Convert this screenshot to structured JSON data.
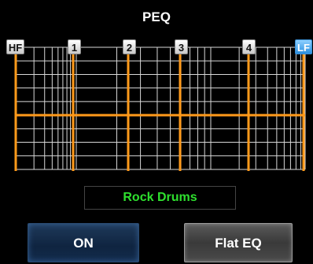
{
  "header": {
    "title": "PEQ"
  },
  "eq": {
    "bands": [
      {
        "id": "hf",
        "label": "HF"
      },
      {
        "id": "b1",
        "label": "1"
      },
      {
        "id": "b2",
        "label": "2"
      },
      {
        "id": "b3",
        "label": "3"
      },
      {
        "id": "b4",
        "label": "4"
      },
      {
        "id": "lf",
        "label": "LF"
      }
    ],
    "curve_color": "#ff9a1a",
    "grid_color": "#d8d8d8",
    "lf_highlight_color": "#3a9ff0"
  },
  "preset": {
    "name": "Rock Drums",
    "color": "#2ee02e"
  },
  "controls": {
    "on_label": "ON",
    "flat_label": "Flat EQ"
  }
}
